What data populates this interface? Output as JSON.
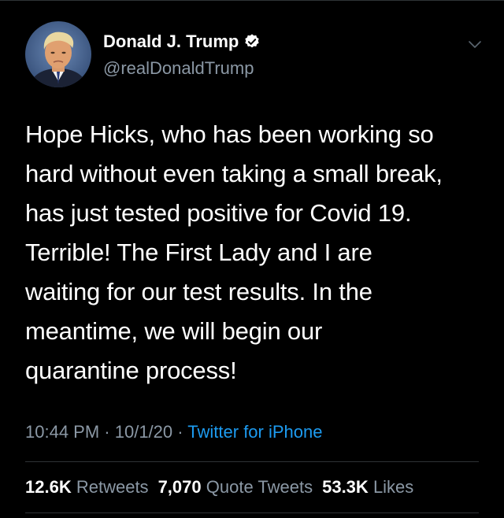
{
  "author": {
    "display_name": "Donald J. Trump",
    "handle": "@realDonaldTrump",
    "verified": true
  },
  "tweet": {
    "lines": [
      "Hope Hicks, who has been working so",
      "hard without even taking a small break,",
      "has just tested positive for Covid 19.",
      "Terrible! The First Lady and I are",
      "waiting for our test results. In the",
      "meantime, we will begin our",
      "quarantine process!"
    ]
  },
  "meta": {
    "time": "10:44 PM",
    "sep1": " · ",
    "date": "10/1/20",
    "sep2": " · ",
    "source": "Twitter for iPhone"
  },
  "stats": {
    "retweets_count": "12.6K",
    "retweets_label": "Retweets",
    "quotes_count": "7,070",
    "quotes_label": "Quote Tweets",
    "likes_count": "53.3K",
    "likes_label": "Likes"
  },
  "icons": {
    "avatar": "avatar-photo",
    "verified": "verified-badge-icon",
    "menu": "chevron-down-icon"
  },
  "colors": {
    "background": "#000000",
    "text": "#ffffff",
    "secondary": "#8b98a5",
    "link": "#1d9bf0",
    "divider": "#2f3336"
  }
}
